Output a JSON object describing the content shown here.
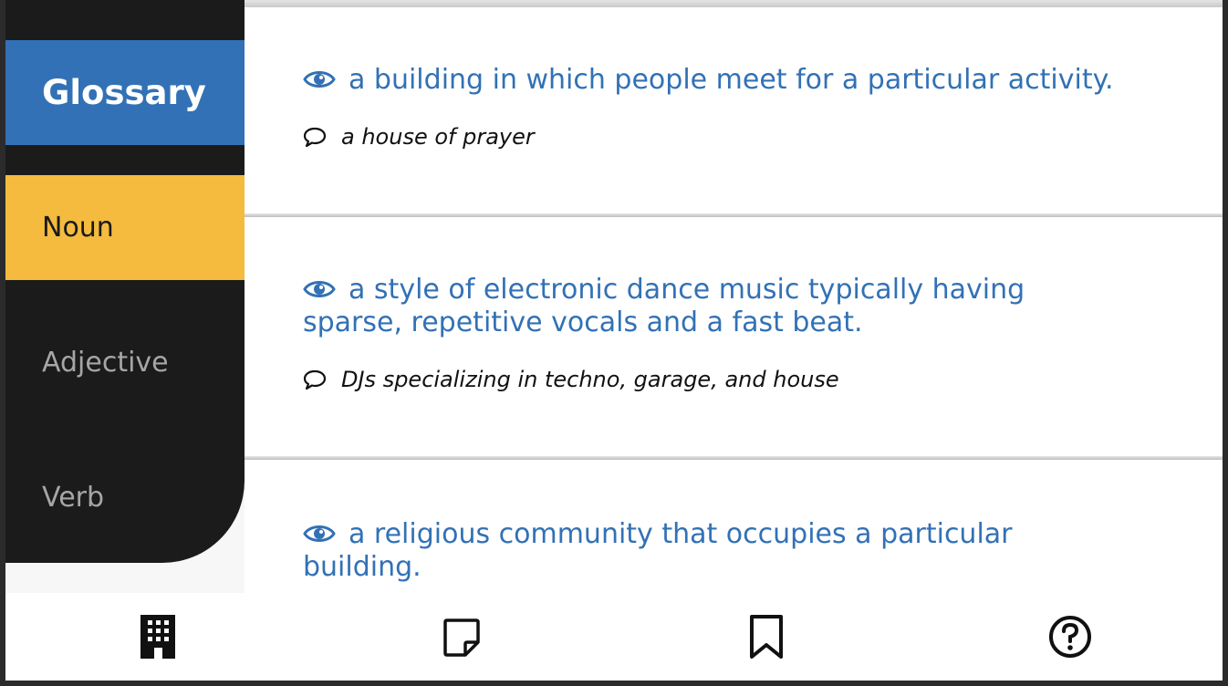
{
  "sidebar": {
    "items": [
      {
        "label": "Glossary",
        "state": "header"
      },
      {
        "label": "Noun",
        "state": "active"
      },
      {
        "label": "Adjective",
        "state": "inactive"
      },
      {
        "label": "Verb",
        "state": "inactive"
      }
    ]
  },
  "entries": [
    {
      "definition": "a building in which people meet for a particular activity.",
      "example": "a house of prayer"
    },
    {
      "definition": "a style of electronic dance music typically having sparse, repetitive vocals and a fast beat.",
      "example": "DJs specializing in techno, garage, and house"
    },
    {
      "definition": "a religious community that occupies a particular building.",
      "example": ""
    }
  ],
  "bottom_nav": {
    "icons": [
      "building-icon",
      "sticky-note-icon",
      "bookmark-icon",
      "help-circle-icon"
    ]
  },
  "colors": {
    "accent_blue": "#3271b5",
    "accent_yellow": "#f4bb3f",
    "sidebar_bg": "#1b1b1b"
  }
}
